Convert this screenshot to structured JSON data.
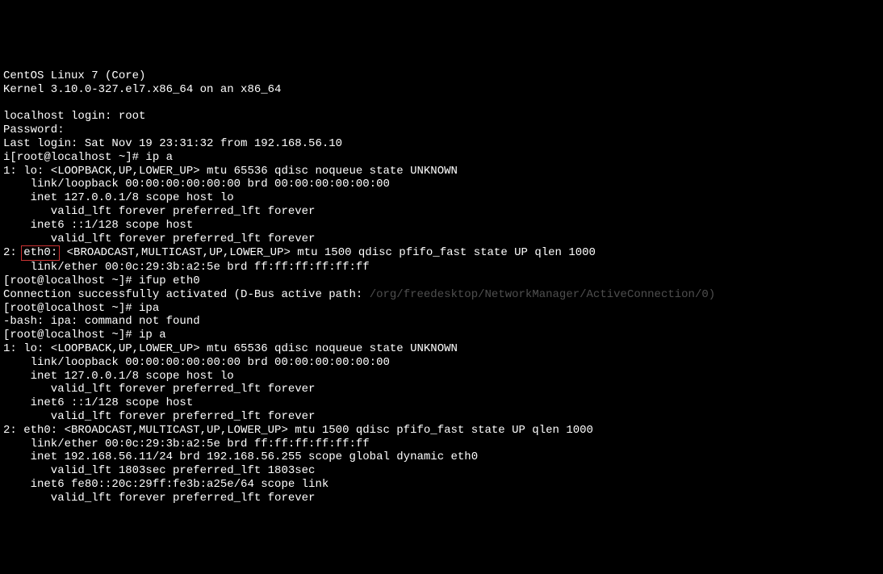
{
  "lines": {
    "l1": "CentOS Linux 7 (Core)",
    "l2": "Kernel 3.10.0-327.el7.x86_64 on an x86_64",
    "l3": "",
    "l4": "localhost login: root",
    "l5": "Password:",
    "l6": "Last login: Sat Nov 19 23:31:32 from 192.168.56.10",
    "l7": "i[root@localhost ~]# ip a",
    "l8": "1: lo: <LOOPBACK,UP,LOWER_UP> mtu 65536 qdisc noqueue state UNKNOWN",
    "l9": "    link/loopback 00:00:00:00:00:00 brd 00:00:00:00:00:00",
    "l10": "    inet 127.0.0.1/8 scope host lo",
    "l11": "       valid_lft forever preferred_lft forever",
    "l12": "    inet6 ::1/128 scope host",
    "l13": "       valid_lft forever preferred_lft forever",
    "l14a": "2: ",
    "l14b": "eth0:",
    "l14c": " <BROADCAST,MULTICAST,UP,LOWER_UP> mtu 1500 qdisc pfifo_fast state UP qlen 1000",
    "l15": "    link/ether 00:0c:29:3b:a2:5e brd ff:ff:ff:ff:ff:ff",
    "l16": "[root@localhost ~]# ifup eth0",
    "l17a": "Connection successfully activated (D-Bus active path: ",
    "l17b": "/org/freedesktop/NetworkManager/ActiveConnection/0)",
    "l18": "[root@localhost ~]# ipa",
    "l19": "-bash: ipa: command not found",
    "l20": "[root@localhost ~]# ip a",
    "l21": "1: lo: <LOOPBACK,UP,LOWER_UP> mtu 65536 qdisc noqueue state UNKNOWN",
    "l22": "    link/loopback 00:00:00:00:00:00 brd 00:00:00:00:00:00",
    "l23": "    inet 127.0.0.1/8 scope host lo",
    "l24": "       valid_lft forever preferred_lft forever",
    "l25": "    inet6 ::1/128 scope host",
    "l26": "       valid_lft forever preferred_lft forever",
    "l27": "2: eth0: <BROADCAST,MULTICAST,UP,LOWER_UP> mtu 1500 qdisc pfifo_fast state UP qlen 1000",
    "l28": "    link/ether 00:0c:29:3b:a2:5e brd ff:ff:ff:ff:ff:ff",
    "l29": "    inet 192.168.56.11/24 brd 192.168.56.255 scope global dynamic eth0",
    "l30": "       valid_lft 1803sec preferred_lft 1803sec",
    "l31": "    inet6 fe80::20c:29ff:fe3b:a25e/64 scope link",
    "l32": "       valid_lft forever preferred_lft forever"
  }
}
